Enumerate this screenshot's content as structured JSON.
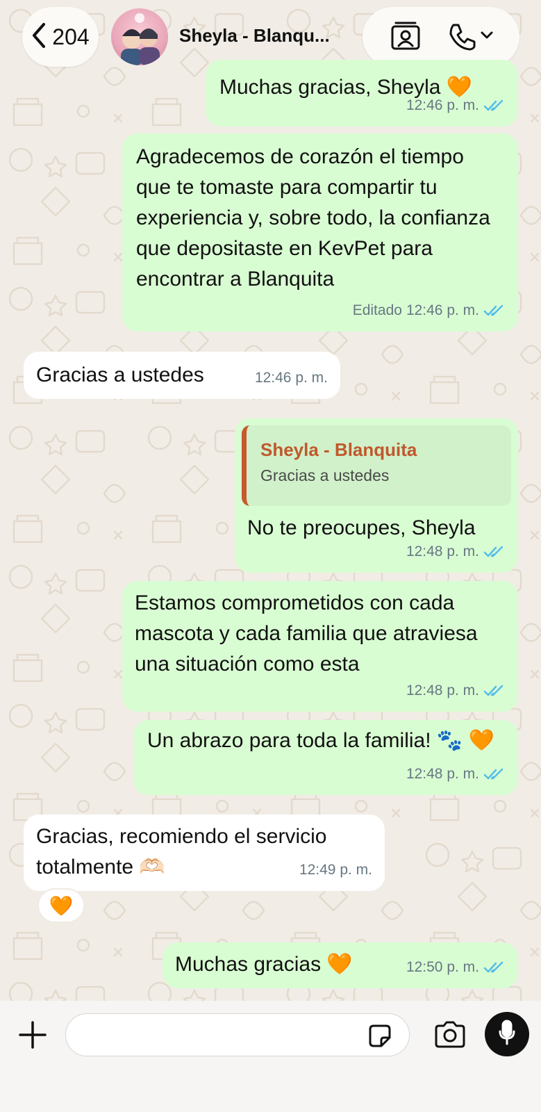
{
  "header": {
    "back_count": "204",
    "contact_name": "Sheyla - Blanqu..."
  },
  "messages": [
    {
      "dir": "out",
      "text": "Muchas gracias, Sheyla 🧡",
      "time": "12:46 p. m."
    },
    {
      "dir": "out",
      "text": "Agradecemos de corazón el tiempo que te tomaste para compartir tu experiencia y, sobre todo, la confianza que depositaste en KevPet para encontrar a Blanquita",
      "edited": "Editado",
      "time": "12:46 p. m."
    },
    {
      "dir": "in",
      "text": "Gracias a ustedes",
      "time": "12:46 p. m."
    },
    {
      "dir": "out",
      "quote_name": "Sheyla - Blanquita",
      "quote_text": "Gracias a ustedes",
      "text": "No te preocupes, Sheyla",
      "time": "12:48 p. m."
    },
    {
      "dir": "out",
      "text": "Estamos comprometidos con cada mascota y cada familia que atraviesa una situación como esta",
      "time": "12:48 p. m."
    },
    {
      "dir": "out",
      "text": "Un abrazo para toda la familia! 🐾 🧡",
      "time": "12:48 p. m."
    },
    {
      "dir": "in",
      "text": "Gracias, recomiendo el servicio totalmente 🫶🏻",
      "time": "12:49 p. m.",
      "reaction": "🧡"
    },
    {
      "dir": "out",
      "text": "Muchas gracias 🧡",
      "time": "12:50 p. m."
    }
  ],
  "colors": {
    "outgoing_bubble": "#d9fdd3",
    "incoming_bubble": "#ffffff",
    "read_ticks": "#53bdeb",
    "quote_accent": "#c55a2d"
  },
  "icons": [
    "chevron-left-icon",
    "contact-card-icon",
    "phone-icon",
    "chevron-down-icon",
    "double-check-icon",
    "plus-icon",
    "sticker-icon",
    "camera-icon",
    "mic-icon",
    "heart-orange-icon",
    "paw-prints-icon",
    "heart-hands-icon"
  ]
}
